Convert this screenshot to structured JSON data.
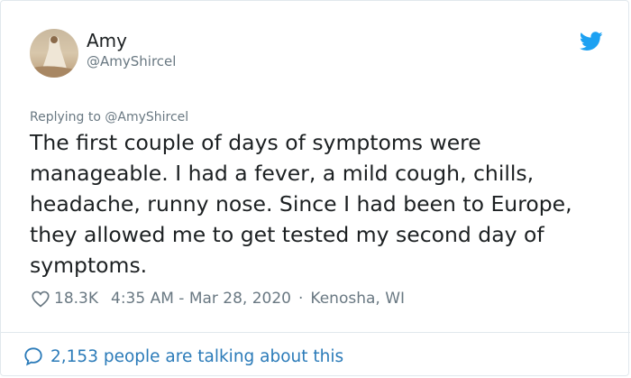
{
  "author": {
    "name": "Amy",
    "handle": "@AmyShircel"
  },
  "reply": {
    "text": "Replying to @AmyShircel"
  },
  "tweet": {
    "text": "The first couple of days of symptoms were manageable. I had a fever, a mild cough, chills, headache, runny nose. Since I had been to Europe, they allowed me to get tested my second day of symptoms."
  },
  "meta": {
    "likes": "18.3K",
    "datetime": "4:35 AM - Mar 28, 2020",
    "separator": "·",
    "location": "Kenosha, WI"
  },
  "discussion": {
    "text": "2,153 people are talking about this"
  },
  "icons": {
    "brand": "twitter-bird-icon",
    "like": "heart-icon",
    "discussion": "speech-bubble-icon"
  },
  "colors": {
    "twitter_blue": "#1da1f2",
    "link_blue": "#2b7bb9",
    "muted": "#697882",
    "text": "#1c2022"
  }
}
